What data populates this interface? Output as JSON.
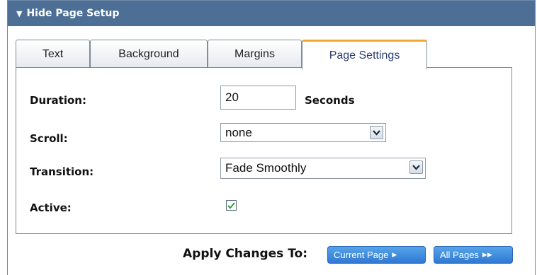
{
  "panel": {
    "header_title": "Hide Page Setup",
    "header_arrow": "▼"
  },
  "tabs": [
    {
      "label": "Text",
      "active": false
    },
    {
      "label": "Background",
      "active": false
    },
    {
      "label": "Margins",
      "active": false
    },
    {
      "label": "Page Settings",
      "active": true
    }
  ],
  "form": {
    "duration": {
      "label": "Duration:",
      "value": "20",
      "unit": "Seconds"
    },
    "scroll": {
      "label": "Scroll:",
      "selected": "none"
    },
    "transition": {
      "label": "Transition:",
      "selected": "Fade Smoothly"
    },
    "active": {
      "label": "Active:",
      "checked": true
    }
  },
  "apply": {
    "label": "Apply Changes To:",
    "current_page": "Current Page",
    "all_pages": "All Pages"
  },
  "colors": {
    "header_bg": "#4d6e95",
    "active_tab_accent": "#f0a830",
    "button_blue": "#3a86db",
    "check_green": "#2e9e3e"
  }
}
